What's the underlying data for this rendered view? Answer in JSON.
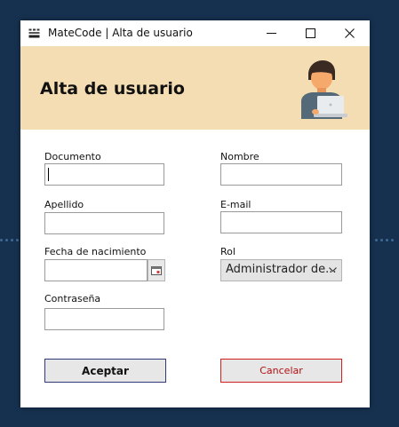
{
  "window": {
    "title": "MateCode | Alta de usuario"
  },
  "header": {
    "title": "Alta de usuario",
    "background_color": "#f5ddb3"
  },
  "form": {
    "documento": {
      "label": "Documento",
      "value": ""
    },
    "nombre": {
      "label": "Nombre",
      "value": ""
    },
    "apellido": {
      "label": "Apellido",
      "value": ""
    },
    "email": {
      "label": "E-mail",
      "value": ""
    },
    "fecha_nacimiento": {
      "label": "Fecha de nacimiento",
      "value": ""
    },
    "rol": {
      "label": "Rol",
      "selected": "Administrador de..."
    },
    "contrasena": {
      "label": "Contraseña",
      "value": ""
    }
  },
  "buttons": {
    "accept": "Aceptar",
    "cancel": "Cancelar"
  },
  "colors": {
    "accept_border": "#2f3b78",
    "cancel_border": "#d11f1f",
    "cancel_text": "#b21010",
    "desktop": "#16314f"
  },
  "icons": [
    "app-icon",
    "minimize-icon",
    "maximize-icon",
    "close-icon",
    "user-laptop-avatar-icon",
    "calendar-icon",
    "chevron-down-icon"
  ]
}
